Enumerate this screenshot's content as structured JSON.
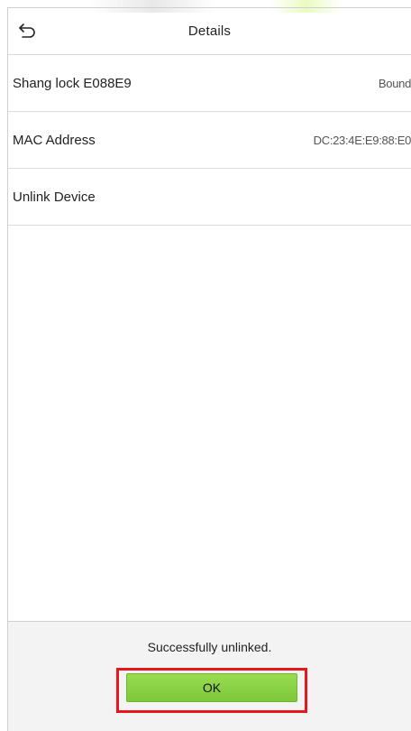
{
  "header": {
    "title": "Details",
    "back_icon": "back-arrow-icon"
  },
  "rows": [
    {
      "label": "Shang lock E088E9",
      "value": "Bound"
    },
    {
      "label": "MAC Address",
      "value": "DC:23:4E:E9:88:E0"
    },
    {
      "label": "Unlink Device",
      "value": ""
    }
  ],
  "dialog": {
    "message": "Successfully unlinked.",
    "ok_label": "OK"
  },
  "colors": {
    "ok_button": "#8bd147",
    "highlight": "#e8161b",
    "dialog_bg": "#f3f3f3"
  }
}
